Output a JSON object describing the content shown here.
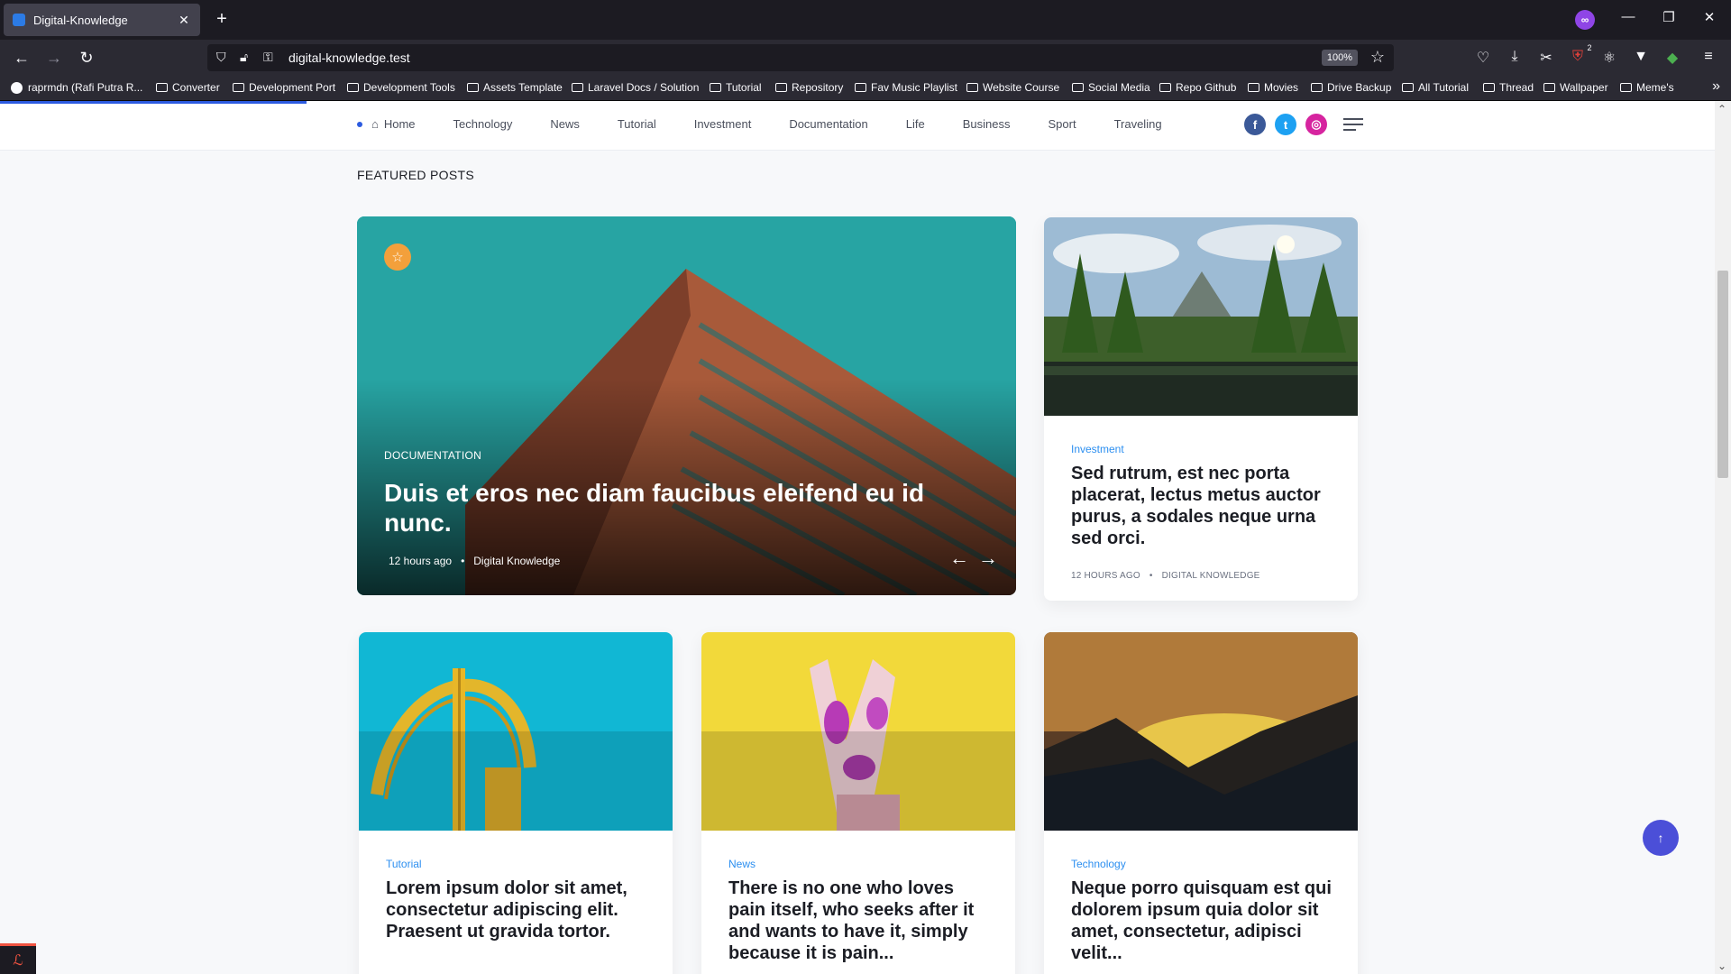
{
  "browser": {
    "tab_title": "Digital-Knowledge",
    "tab_close": "✕",
    "new_tab": "+",
    "url": "digital-knowledge.test",
    "zoom": "100%",
    "bookmarks": [
      "raprmdn (Rafi Putra R...",
      "Converter",
      "Development Port",
      "Development Tools",
      "Assets Template",
      "Laravel Docs / Solution",
      "Tutorial",
      "Repository",
      "Fav Music Playlist",
      "Website Course",
      "Social Media",
      "Repo Github",
      "Movies",
      "Drive Backup",
      "All Tutorial",
      "Thread",
      "Wallpaper",
      "Meme's"
    ],
    "extension_badge": "2"
  },
  "site": {
    "menu": [
      "Home",
      "Technology",
      "News",
      "Tutorial",
      "Investment",
      "Documentation",
      "Life",
      "Business",
      "Sport",
      "Traveling"
    ],
    "social": [
      {
        "icon": "facebook-icon",
        "glyph": "f",
        "color": "#3b5998"
      },
      {
        "icon": "twitter-icon",
        "glyph": "t",
        "color": "#1da1f2"
      },
      {
        "icon": "instagram-icon",
        "glyph": "◎",
        "color": "#d6249f"
      }
    ],
    "section_title": "FEATURED POSTS"
  },
  "hero": {
    "category": "DOCUMENTATION",
    "title": "Duis et eros nec diam faucibus eleifend eu id nunc.",
    "time": "12 hours ago",
    "author": "Digital Knowledge",
    "prev": "←",
    "next": "→"
  },
  "cards": [
    {
      "category": "Investment",
      "title": "Sed rutrum, est nec porta placerat, lectus metus auctor purus, a sodales neque urna sed orci.",
      "time": "12 HOURS AGO",
      "author": "DIGITAL KNOWLEDGE"
    },
    {
      "category": "Tutorial",
      "title": "Lorem ipsum dolor sit amet, consectetur adipiscing elit. Praesent ut gravida tortor."
    },
    {
      "category": "News",
      "title": "There is no one who loves pain itself, who seeks after it and wants to have it, simply because it is pain..."
    },
    {
      "category": "Technology",
      "title": "Neque porro quisquam est qui dolorem ipsum quia dolor sit amet, consectetur, adipisci velit..."
    }
  ],
  "colors": {
    "accent": "#2c5be0",
    "category": "#2c8ff0",
    "to_top": "#4b4fd8"
  }
}
